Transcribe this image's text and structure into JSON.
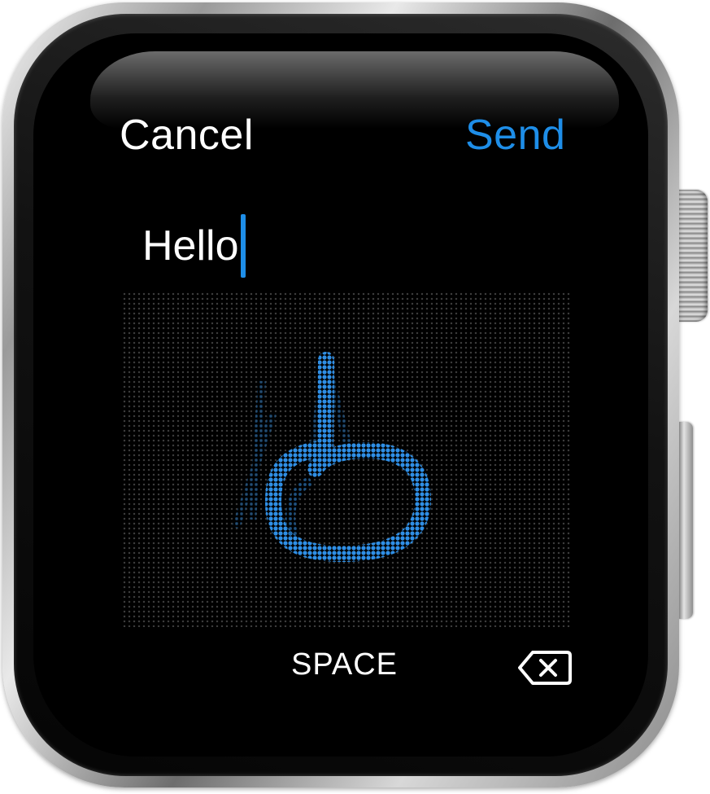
{
  "header": {
    "cancel_label": "Cancel",
    "send_label": "Send"
  },
  "input": {
    "value": "Hello"
  },
  "keys": {
    "space_label": "SPACE",
    "delete_icon": "delete-backward-icon"
  },
  "handwriting": {
    "stroke_glyph": "o"
  },
  "colors": {
    "accent": "#1e8ee8",
    "stroke": "#2f8fe6",
    "background": "#000000",
    "text": "#ffffff"
  }
}
